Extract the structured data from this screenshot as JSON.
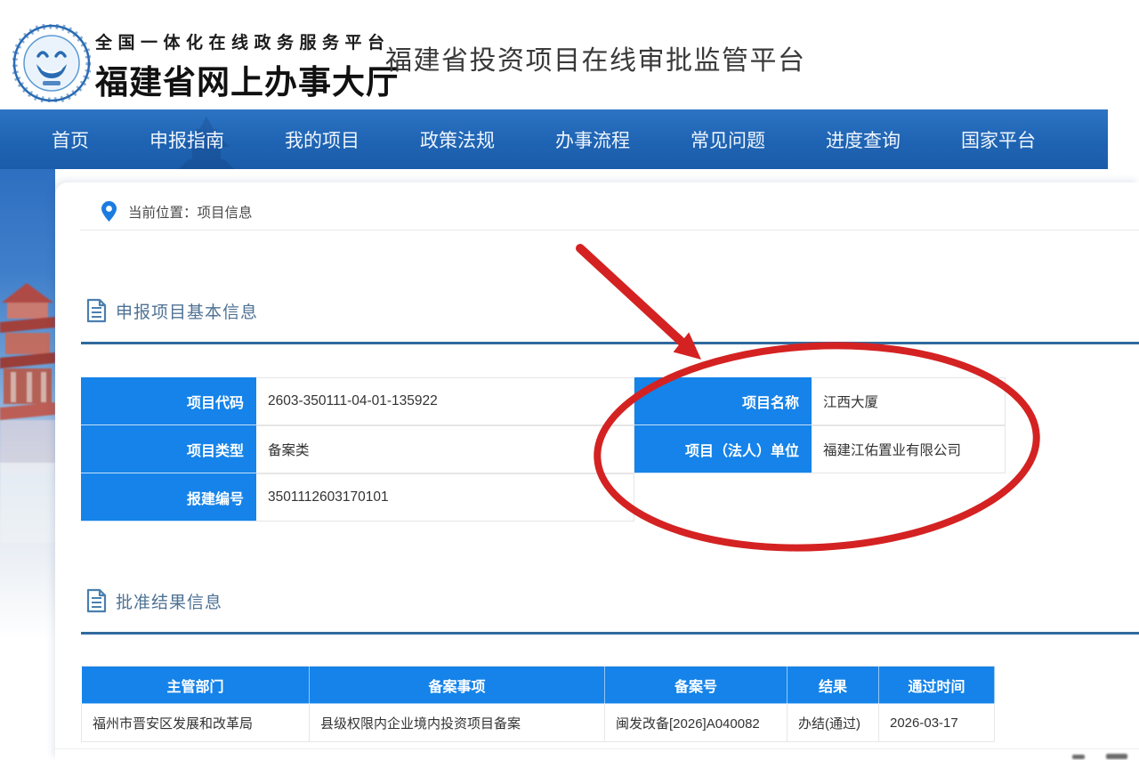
{
  "header": {
    "platform_tagline": "全国一体化在线政务服务平台",
    "portal_name": "福建省网上办事大厅",
    "site_title": "福建省投资项目在线审批监管平台"
  },
  "nav": {
    "items": [
      {
        "label": "首页"
      },
      {
        "label": "申报指南"
      },
      {
        "label": "我的项目"
      },
      {
        "label": "政策法规"
      },
      {
        "label": "办事流程"
      },
      {
        "label": "常见问题"
      },
      {
        "label": "进度查询"
      },
      {
        "label": "国家平台"
      }
    ]
  },
  "breadcrumb": {
    "text": "当前位置：项目信息"
  },
  "sections": {
    "basic_title": "申报项目基本信息",
    "result_title": "批准结果信息"
  },
  "basic_info": {
    "left": [
      {
        "label": "项目代码",
        "value": "2603-350111-04-01-135922"
      },
      {
        "label": "项目类型",
        "value": "备案类"
      },
      {
        "label": "报建编号",
        "value": "3501112603170101"
      }
    ],
    "right": [
      {
        "label": "项目名称",
        "value": "江西大厦"
      },
      {
        "label": "项目（法人）单位",
        "value": "福建江佑置业有限公司"
      }
    ]
  },
  "result_table": {
    "headers": [
      "主管部门",
      "备案事项",
      "备案号",
      "结果",
      "通过时间"
    ],
    "rows": [
      [
        "福州市晋安区发展和改革局",
        "县级权限内企业境内投资项目备案",
        "闽发改备[2026]A040082",
        "办结(通过)",
        "2026-03-17"
      ]
    ]
  },
  "colors": {
    "nav_blue": "#1f64b3",
    "label_blue": "#1583e9",
    "section_rule_blue": "#30699e",
    "annotation_red": "#d42222"
  }
}
